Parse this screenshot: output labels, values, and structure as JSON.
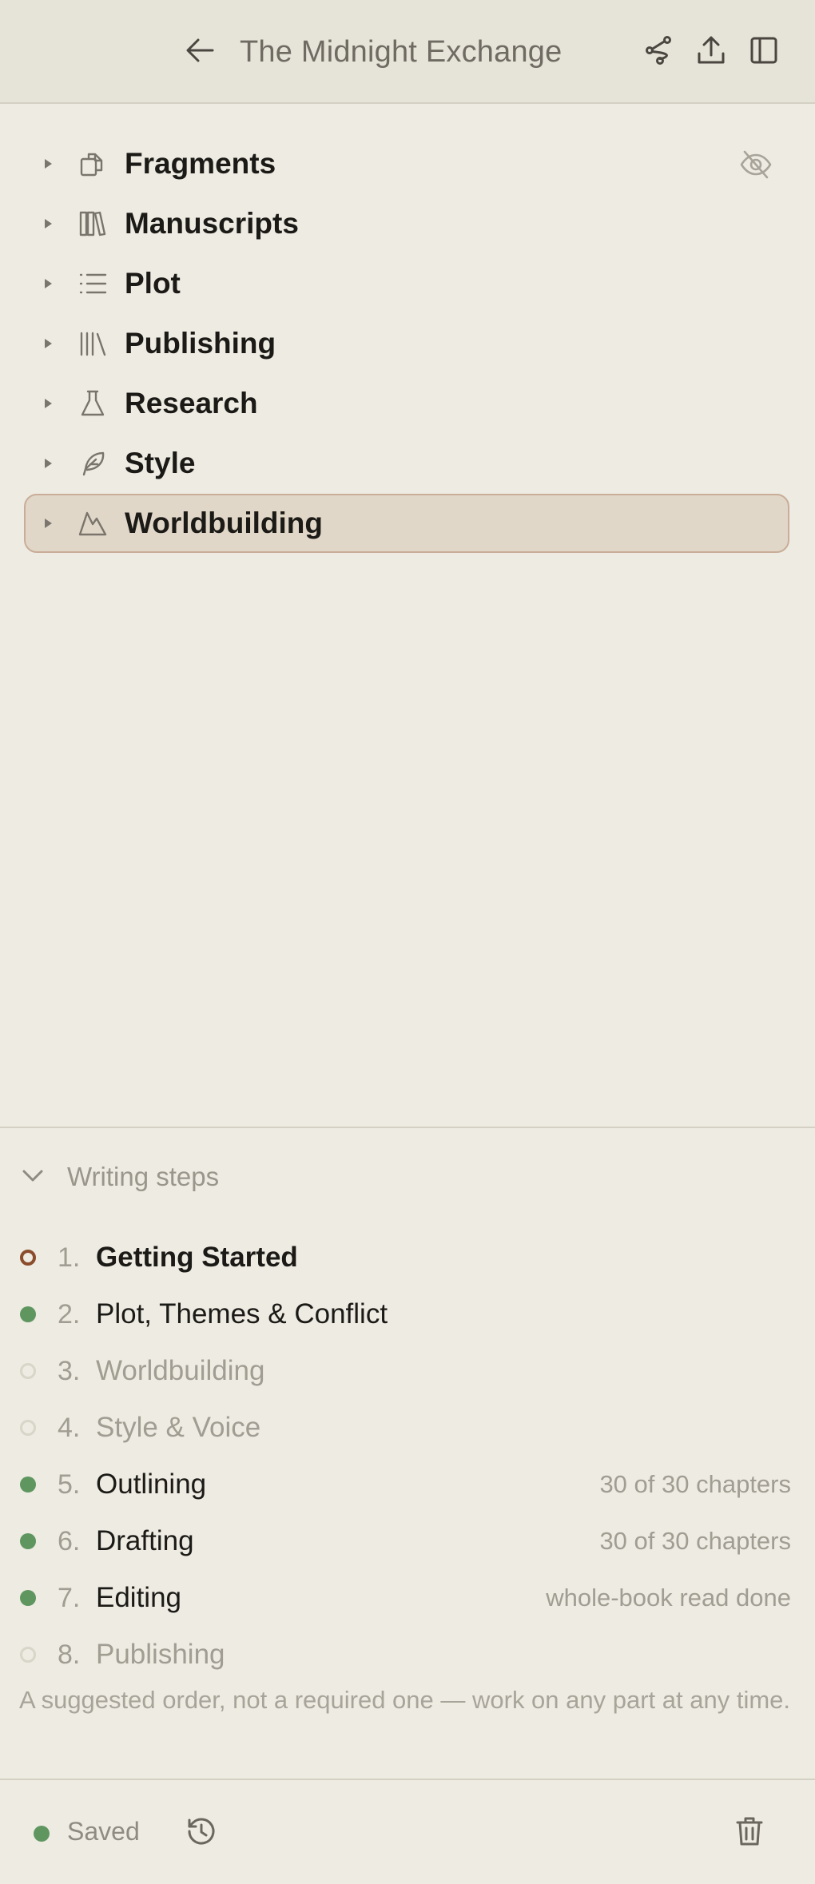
{
  "header": {
    "title": "The Midnight Exchange",
    "back_icon": "arrow-left-icon",
    "actions": [
      "graph-icon",
      "upload-icon",
      "sidebar-panel-icon"
    ]
  },
  "tree": {
    "items": [
      {
        "label": "Fragments",
        "icon": "copy-icon",
        "hidden_toggle": "eye-off-icon"
      },
      {
        "label": "Manuscripts",
        "icon": "books-icon"
      },
      {
        "label": "Plot",
        "icon": "list-icon"
      },
      {
        "label": "Publishing",
        "icon": "library-icon"
      },
      {
        "label": "Research",
        "icon": "flask-icon"
      },
      {
        "label": "Style",
        "icon": "feather-icon"
      },
      {
        "label": "Worldbuilding",
        "icon": "mountain-icon",
        "selected": true
      }
    ]
  },
  "writing_steps": {
    "title": "Writing steps",
    "steps": [
      {
        "number": "1.",
        "label": "Getting Started",
        "status": "current",
        "meta": ""
      },
      {
        "number": "2.",
        "label": "Plot, Themes & Conflict",
        "status": "done",
        "meta": ""
      },
      {
        "number": "3.",
        "label": "Worldbuilding",
        "status": "todo",
        "meta": ""
      },
      {
        "number": "4.",
        "label": "Style & Voice",
        "status": "todo",
        "meta": ""
      },
      {
        "number": "5.",
        "label": "Outlining",
        "status": "done",
        "meta": "30 of 30 chapters"
      },
      {
        "number": "6.",
        "label": "Drafting",
        "status": "done",
        "meta": "30 of 30 chapters"
      },
      {
        "number": "7.",
        "label": "Editing",
        "status": "done",
        "meta": "whole-book read done"
      },
      {
        "number": "8.",
        "label": "Publishing",
        "status": "todo",
        "meta": ""
      }
    ],
    "note": "A suggested order, not a required one — work on any part at any time."
  },
  "footer": {
    "status_label": "Saved",
    "history_icon": "history-icon",
    "delete_icon": "trash-icon"
  },
  "colors": {
    "background": "#edebe2",
    "header_bg": "#e6e3d8",
    "selected_bg": "#e1d7c8",
    "selected_border": "#c9ad98",
    "done_green": "#5f9660",
    "current_brown": "#8b4c2c"
  }
}
